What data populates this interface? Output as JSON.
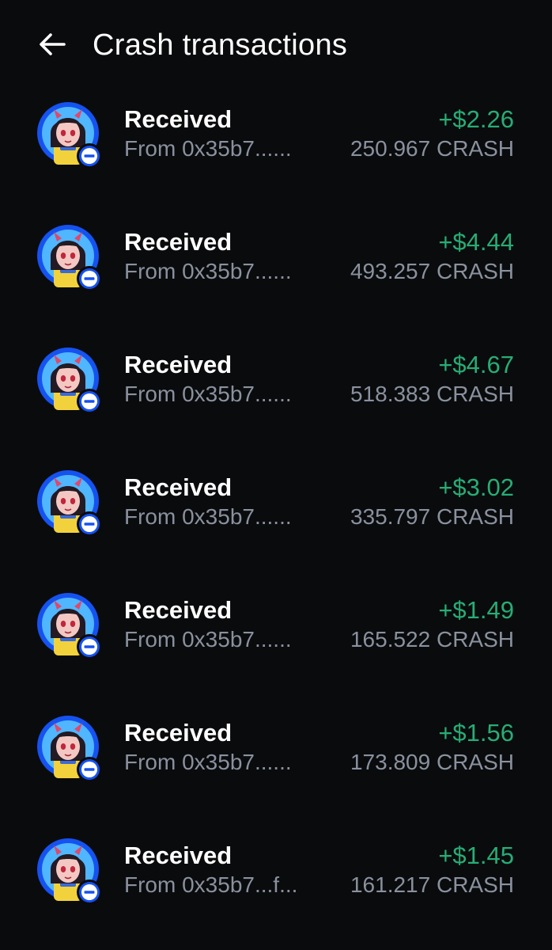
{
  "header": {
    "title": "Crash transactions",
    "back_icon": "arrow-left-icon"
  },
  "colors": {
    "background": "#0a0b0d",
    "positive": "#27ad75",
    "secondary_text": "#8a919e",
    "avatar_ring": "#1652f0"
  },
  "transactions": [
    {
      "title": "Received",
      "from": "From 0x35b7......",
      "usd": "+$2.26",
      "token_amount": "250.967 CRASH"
    },
    {
      "title": "Received",
      "from": "From 0x35b7......",
      "usd": "+$4.44",
      "token_amount": "493.257 CRASH"
    },
    {
      "title": "Received",
      "from": "From 0x35b7......",
      "usd": "+$4.67",
      "token_amount": "518.383 CRASH"
    },
    {
      "title": "Received",
      "from": "From 0x35b7......",
      "usd": "+$3.02",
      "token_amount": "335.797 CRASH"
    },
    {
      "title": "Received",
      "from": "From 0x35b7......",
      "usd": "+$1.49",
      "token_amount": "165.522 CRASH"
    },
    {
      "title": "Received",
      "from": "From 0x35b7......",
      "usd": "+$1.56",
      "token_amount": "173.809 CRASH"
    },
    {
      "title": "Received",
      "from": "From 0x35b7...f...",
      "usd": "+$1.45",
      "token_amount": "161.217 CRASH"
    }
  ]
}
